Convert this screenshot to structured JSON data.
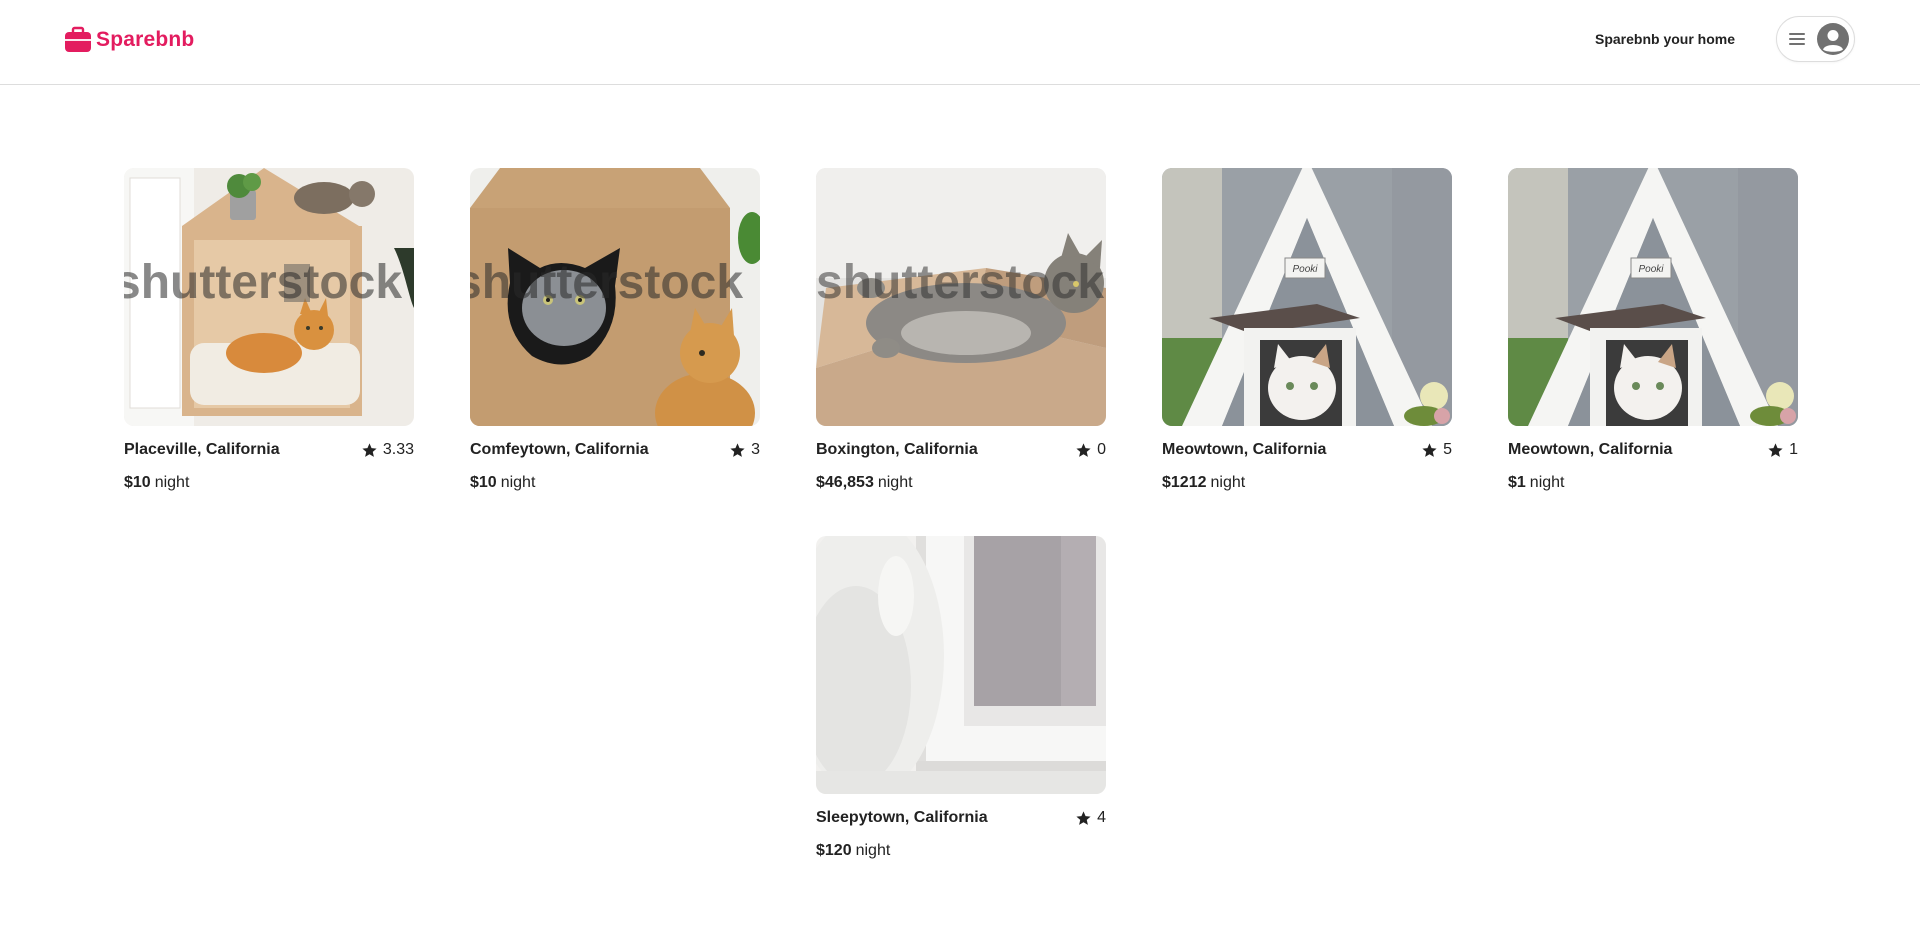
{
  "header": {
    "brand": "Sparebnb",
    "host_link": "Sparebnb your home",
    "brand_color": "#e31c5f"
  },
  "icons": {
    "logo": "briefcase-icon",
    "menu": "hamburger-menu-icon",
    "avatar": "user-avatar-icon",
    "rating": "star-icon"
  },
  "listings": [
    {
      "location": "Placeville, California",
      "rating": "3.33",
      "price": "$10",
      "unit": "night",
      "image": "orange cat in cardboard cat house, tabby cat on roof",
      "watermark": "shutterstock"
    },
    {
      "location": "Comfeytown, California",
      "rating": "3",
      "price": "$10",
      "unit": "night",
      "image": "grey cat peeking from cat-shaped hole in cardboard house",
      "watermark": "shutterstock"
    },
    {
      "location": "Boxington, California",
      "rating": "0",
      "price": "$46,853",
      "unit": "night",
      "image": "grey cat lying in open cardboard box",
      "watermark": "shutterstock"
    },
    {
      "location": "Meowtown, California",
      "rating": "5",
      "price": "$1212",
      "unit": "night",
      "image": "white cat in grey A-frame wooden cat house",
      "sign": "Pooki"
    },
    {
      "location": "Meowtown, California",
      "rating": "1",
      "price": "$1",
      "unit": "night",
      "image": "white cat in grey A-frame wooden cat house",
      "sign": "Pooki"
    },
    {
      "location": "Sleepytown, California",
      "rating": "4",
      "price": "$120",
      "unit": "night",
      "image": "white fluffy cat beside white wooden door"
    }
  ]
}
